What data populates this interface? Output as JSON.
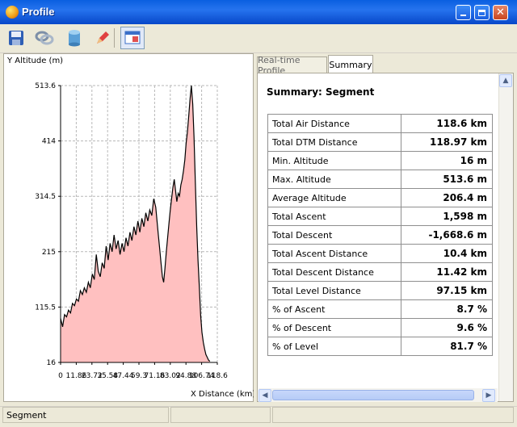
{
  "window": {
    "title": "Profile"
  },
  "toolbar": {
    "buttons": [
      {
        "icon": "save-icon"
      },
      {
        "icon": "links-icon"
      },
      {
        "icon": "database-icon"
      },
      {
        "icon": "pencil-icon"
      },
      {
        "icon": "window-icon"
      }
    ]
  },
  "tabs": {
    "realtime": "Real-time Profile",
    "summary": "Summary"
  },
  "summary": {
    "title": "Summary: Segment",
    "rows": [
      {
        "label": "Total Air Distance",
        "value": "118.6 km"
      },
      {
        "label": "Total DTM Distance",
        "value": "118.97 km"
      },
      {
        "label": "Min. Altitude",
        "value": "16 m"
      },
      {
        "label": "Max. Altitude",
        "value": "513.6 m"
      },
      {
        "label": "Average Altitude",
        "value": "206.4 m"
      },
      {
        "label": "Total Ascent",
        "value": "1,598 m"
      },
      {
        "label": "Total Descent",
        "value": "-1,668.6 m"
      },
      {
        "label": "Total Ascent Distance",
        "value": "10.4 km"
      },
      {
        "label": "Total Descent Distance",
        "value": "11.42 km"
      },
      {
        "label": "Total Level Distance",
        "value": "97.15 km"
      },
      {
        "label": "% of Ascent",
        "value": "8.7 %"
      },
      {
        "label": "% of Descent",
        "value": "9.6 %"
      },
      {
        "label": "% of Level",
        "value": "81.7 %"
      }
    ]
  },
  "status": {
    "text": "Segment"
  },
  "chart_data": {
    "type": "area",
    "ylabel": "Y Altitude (m)",
    "xlabel": "X Distance (km)",
    "yticks": [
      "513.6",
      "414",
      "314.5",
      "215",
      "115.5",
      "16"
    ],
    "xticks": [
      "0",
      "11.86",
      "23.72",
      "35.58",
      "47.44",
      "59.3",
      "71.16",
      "83.02",
      "94.88",
      "106.74",
      "118.6"
    ],
    "xlim": [
      0,
      118.6
    ],
    "ylim": [
      16,
      513.6
    ],
    "grid": true,
    "color": "#ffc0c0",
    "line_color": "#000000",
    "points": [
      [
        0,
        95
      ],
      [
        1.5,
        80
      ],
      [
        3,
        102
      ],
      [
        4.5,
        98
      ],
      [
        6,
        110
      ],
      [
        7.5,
        105
      ],
      [
        9,
        122
      ],
      [
        10.5,
        118
      ],
      [
        12,
        130
      ],
      [
        13.5,
        126
      ],
      [
        15,
        145
      ],
      [
        16.5,
        138
      ],
      [
        18,
        150
      ],
      [
        19.5,
        142
      ],
      [
        21,
        160
      ],
      [
        22.5,
        150
      ],
      [
        24,
        175
      ],
      [
        25.5,
        165
      ],
      [
        27,
        210
      ],
      [
        28.5,
        180
      ],
      [
        30,
        170
      ],
      [
        31.5,
        195
      ],
      [
        33,
        185
      ],
      [
        34.5,
        225
      ],
      [
        36,
        200
      ],
      [
        37.5,
        230
      ],
      [
        39,
        215
      ],
      [
        40.5,
        245
      ],
      [
        42,
        220
      ],
      [
        43.5,
        235
      ],
      [
        45,
        210
      ],
      [
        46.5,
        230
      ],
      [
        48,
        215
      ],
      [
        49.5,
        240
      ],
      [
        51,
        225
      ],
      [
        52.5,
        250
      ],
      [
        54,
        235
      ],
      [
        55.5,
        260
      ],
      [
        57,
        245
      ],
      [
        58.5,
        270
      ],
      [
        60,
        250
      ],
      [
        61.5,
        275
      ],
      [
        63,
        260
      ],
      [
        64.5,
        285
      ],
      [
        66,
        270
      ],
      [
        67.5,
        290
      ],
      [
        69,
        280
      ],
      [
        70.5,
        310
      ],
      [
        72,
        295
      ],
      [
        73,
        270
      ],
      [
        74,
        245
      ],
      [
        75,
        220
      ],
      [
        76,
        195
      ],
      [
        77,
        170
      ],
      [
        78,
        160
      ],
      [
        79,
        185
      ],
      [
        80,
        215
      ],
      [
        81,
        240
      ],
      [
        82,
        265
      ],
      [
        83,
        290
      ],
      [
        84,
        310
      ],
      [
        85,
        330
      ],
      [
        86,
        345
      ],
      [
        87,
        325
      ],
      [
        88,
        305
      ],
      [
        89,
        320
      ],
      [
        90,
        315
      ],
      [
        91,
        335
      ],
      [
        92,
        345
      ],
      [
        93,
        360
      ],
      [
        94,
        380
      ],
      [
        95,
        410
      ],
      [
        96,
        430
      ],
      [
        97,
        460
      ],
      [
        98,
        490
      ],
      [
        99,
        513.6
      ],
      [
        100,
        480
      ],
      [
        101,
        420
      ],
      [
        102,
        340
      ],
      [
        103,
        260
      ],
      [
        104,
        200
      ],
      [
        105,
        150
      ],
      [
        106,
        100
      ],
      [
        107,
        70
      ],
      [
        108,
        52
      ],
      [
        109,
        40
      ],
      [
        110,
        30
      ],
      [
        111,
        25
      ],
      [
        112,
        20
      ],
      [
        113,
        18
      ]
    ]
  }
}
